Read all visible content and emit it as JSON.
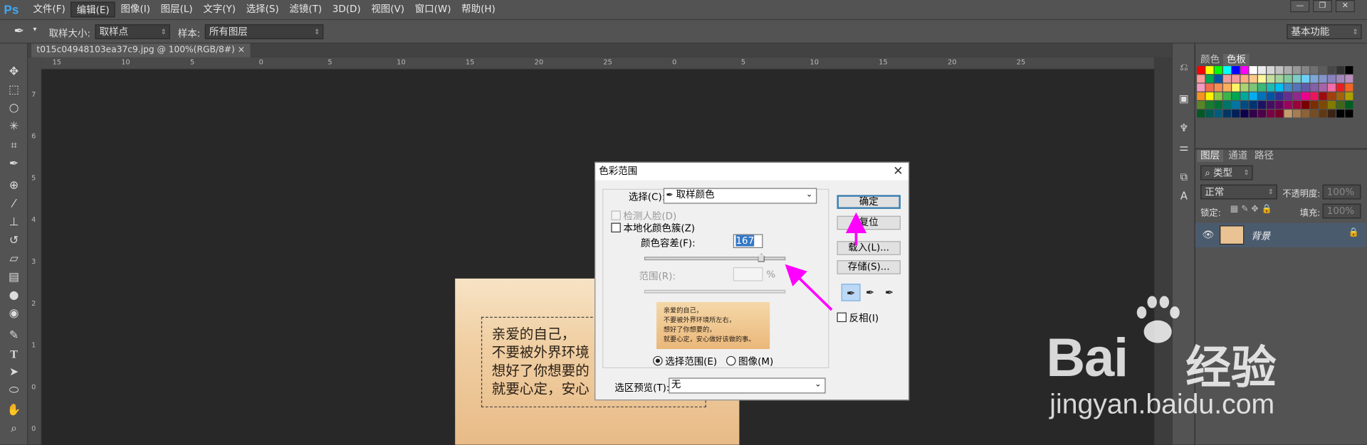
{
  "app": {
    "logo": "Ps"
  },
  "menu": [
    "文件(F)",
    "编辑(E)",
    "图像(I)",
    "图层(L)",
    "文字(Y)",
    "选择(S)",
    "滤镜(T)",
    "3D(D)",
    "视图(V)",
    "窗口(W)",
    "帮助(H)"
  ],
  "window_buttons": {
    "minimize": "—",
    "restore": "❐",
    "close": "✕"
  },
  "options": {
    "sample_size_label": "取样大小:",
    "sample_size_value": "取样点",
    "sample_label": "样本:",
    "sample_value": "所有图层",
    "workspace": "基本功能"
  },
  "document_tab": {
    "title": "t015c04948103ea37c9.jpg @ 100%(RGB/8#)",
    "close": "×"
  },
  "ruler": {
    "top_ticks": [
      "15",
      "10",
      "5",
      "0",
      "5",
      "10",
      "15",
      "20",
      "25",
      "0",
      "5",
      "10",
      "15",
      "20",
      "25"
    ],
    "left_ticks": [
      "7",
      "6",
      "5",
      "4",
      "3",
      "2",
      "1",
      "0",
      "0"
    ]
  },
  "document_text": [
    "亲爱的自己，",
    "不要被外界环境",
    "想好了你想要的",
    "就要心定，安心"
  ],
  "dialog": {
    "title": "色彩范围",
    "close": "✕",
    "select_label": "选择(C):",
    "select_value": "取样颜色",
    "detect_faces": "检测人脸(D)",
    "localized": "本地化颜色簇(Z)",
    "fuzziness_label": "颜色容差(F):",
    "fuzziness_value": "167",
    "fuzziness_percent": 0.83,
    "range_label": "范围(R):",
    "range_unit": "%",
    "preview_text": [
      "亲爱的自己，",
      "不要被外界环境所左右，",
      "想好了你想要的，",
      "就要心定，安心做好该做的事。"
    ],
    "radio_selection": "选择范围(E)",
    "radio_image": "图像(M)",
    "preview_mode_label": "选区预览(T):",
    "preview_mode_value": "无",
    "buttons": {
      "ok": "确定",
      "reset": "复位",
      "load": "载入(L)...",
      "save": "存储(S)..."
    },
    "invert": "反相(I)"
  },
  "panels": {
    "color_tabs": [
      "颜色",
      "色板"
    ],
    "layer_tabs": [
      "图层",
      "通道",
      "路径"
    ],
    "filter_kind": "类型",
    "blend_mode": "正常",
    "opacity_label": "不透明度:",
    "opacity_value": "100%",
    "lock_label": "锁定:",
    "fill_label": "填充:",
    "fill_value": "100%",
    "layer_name": "背景"
  },
  "colors": {
    "accent": "#ff00ff",
    "swatches": [
      "#ff0000",
      "#ffff00",
      "#00ff00",
      "#00ffff",
      "#0000ff",
      "#ff00ff",
      "#ffffff",
      "#ebebeb",
      "#d6d6d6",
      "#c2c2c2",
      "#adadad",
      "#999999",
      "#858585",
      "#707070",
      "#5c5c5c",
      "#474747",
      "#333333",
      "#000000",
      "#ff9a9a",
      "#00a651",
      "#0054a6",
      "#ef9b9b",
      "#f5989d",
      "#f9ad81",
      "#fdc68a",
      "#fff799",
      "#c4df9b",
      "#a3d39c",
      "#82ca9d",
      "#7bcdc8",
      "#6ecff6",
      "#7ea7d8",
      "#8493ca",
      "#8882be",
      "#a187be",
      "#bc8dbf",
      "#f49ac1",
      "#f26c4f",
      "#f68e55",
      "#fbaf5c",
      "#fff467",
      "#acd372",
      "#7cc576",
      "#3bb878",
      "#1abbb4",
      "#00bff3",
      "#438ccb",
      "#5574b9",
      "#605ca8",
      "#855fa8",
      "#a763a8",
      "#f06ea9",
      "#ed1c24",
      "#f26522",
      "#f7941d",
      "#fff200",
      "#8dc73f",
      "#39b54a",
      "#00a651",
      "#00a99d",
      "#00aeef",
      "#0072bc",
      "#0054a6",
      "#2e3192",
      "#662d91",
      "#92278f",
      "#ec008c",
      "#ed145b",
      "#9e0b0f",
      "#a0410d",
      "#a3620a",
      "#aba000",
      "#598527",
      "#197b30",
      "#007236",
      "#00746b",
      "#0076a3",
      "#004b80",
      "#003471",
      "#1b1464",
      "#440e62",
      "#630460",
      "#9e005d",
      "#9e0039",
      "#790000",
      "#7b2e00",
      "#7d4900",
      "#827b00",
      "#406618",
      "#005e20",
      "#005826",
      "#005952",
      "#005b7f",
      "#003663",
      "#002157",
      "#0d004c",
      "#32004b",
      "#4b0049",
      "#7b0046",
      "#7a0026",
      "#c69c6d",
      "#a67c52",
      "#8c6239",
      "#754c24",
      "#603913",
      "#3c2415",
      "#000000",
      "#000000"
    ]
  },
  "watermark": {
    "brand": "Bai",
    "brand2": "经验",
    "url": "jingyan.baidu.com"
  }
}
